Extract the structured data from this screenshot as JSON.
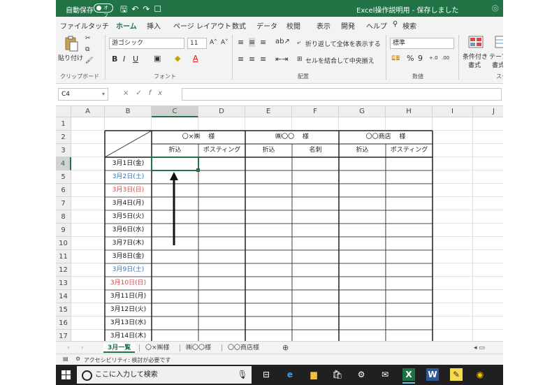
{
  "titlebar": {
    "autosave_label": "自動保存",
    "autosave_state": "オフ",
    "doc_title": "Excel操作説明用 - 保存しました"
  },
  "ribbon_tabs": [
    "ファイル",
    "タッチ",
    "ホーム",
    "挿入",
    "ページ レイアウト",
    "数式",
    "データ",
    "校閲",
    "表示",
    "開発",
    "ヘルプ"
  ],
  "ribbon_search": "検索",
  "ribbon": {
    "paste_label": "貼り付け",
    "font_name": "游ゴシック",
    "font_size": "11",
    "font_grow": "A˄",
    "font_shrink": "A˅",
    "bold": "B",
    "italic": "I",
    "underline": "U",
    "font_color_glyph": "A",
    "wrap_text": "折り返して全体を表示する",
    "merge_center": "セルを結合して中央揃え",
    "number_format": "標準",
    "percent": "%",
    "comma": "9",
    "decimal_up": "+.0",
    "decimal_down": ".00",
    "cond_format": "条件付き",
    "cond_format_sub": "書式",
    "table_format": "テーブル",
    "table_format_sub": "書式",
    "groups": {
      "clipboard": "クリップボード",
      "font": "フォント",
      "alignment": "配置",
      "number": "数値",
      "styles": "スタ"
    }
  },
  "formula_bar": {
    "name_box": "C4",
    "cancel": "×",
    "enter": "✓",
    "fx": "fx",
    "value": ""
  },
  "columns": [
    "A",
    "B",
    "C",
    "D",
    "E",
    "F",
    "G",
    "H",
    "I",
    "J"
  ],
  "rows": [
    "1",
    "2",
    "3",
    "4",
    "5",
    "6",
    "7",
    "8",
    "9",
    "10",
    "11",
    "12",
    "13",
    "14",
    "15",
    "16",
    "17"
  ],
  "selected_cell": "C4",
  "table": {
    "clients": [
      "〇×㈱　 様",
      "㈱〇〇　 様",
      "〇〇商店　 様"
    ],
    "subheaders": [
      "折込",
      "ポスティング",
      "折込",
      "名刺",
      "折込",
      "ポスティング"
    ],
    "dates": [
      {
        "label": "3月1日(金)",
        "kind": "weekday"
      },
      {
        "label": "3月2日(土)",
        "kind": "saturday"
      },
      {
        "label": "3月3日(日)",
        "kind": "sunday"
      },
      {
        "label": "3月4日(月)",
        "kind": "weekday"
      },
      {
        "label": "3月5日(火)",
        "kind": "weekday"
      },
      {
        "label": "3月6日(水)",
        "kind": "weekday"
      },
      {
        "label": "3月7日(木)",
        "kind": "weekday"
      },
      {
        "label": "3月8日(金)",
        "kind": "weekday"
      },
      {
        "label": "3月9日(土)",
        "kind": "saturday"
      },
      {
        "label": "3月10日(日)",
        "kind": "sunday"
      },
      {
        "label": "3月11日(月)",
        "kind": "weekday"
      },
      {
        "label": "3月12日(火)",
        "kind": "weekday"
      },
      {
        "label": "3月13日(水)",
        "kind": "weekday"
      },
      {
        "label": "3月14日(木)",
        "kind": "weekday"
      }
    ]
  },
  "sheet_tabs": [
    "3月一覧",
    "〇×㈱様",
    "㈱〇〇様",
    "〇〇商店様"
  ],
  "active_sheet": "3月一覧",
  "add_sheet": "⊕",
  "status_text": "アクセシビリティ: 検討が必要です",
  "taskbar": {
    "search_placeholder": "ここに入力して検索",
    "app_icons": [
      "mic-icon",
      "task-view-icon",
      "edge-icon",
      "file-explorer-icon",
      "store-icon",
      "settings-icon",
      "mail-icon",
      "excel-icon",
      "word-icon",
      "sticky-notes-icon",
      "chrome-icon"
    ]
  },
  "colors": {
    "excel_green": "#217346",
    "saturday": "#2e75b6",
    "sunday": "#e04040"
  }
}
